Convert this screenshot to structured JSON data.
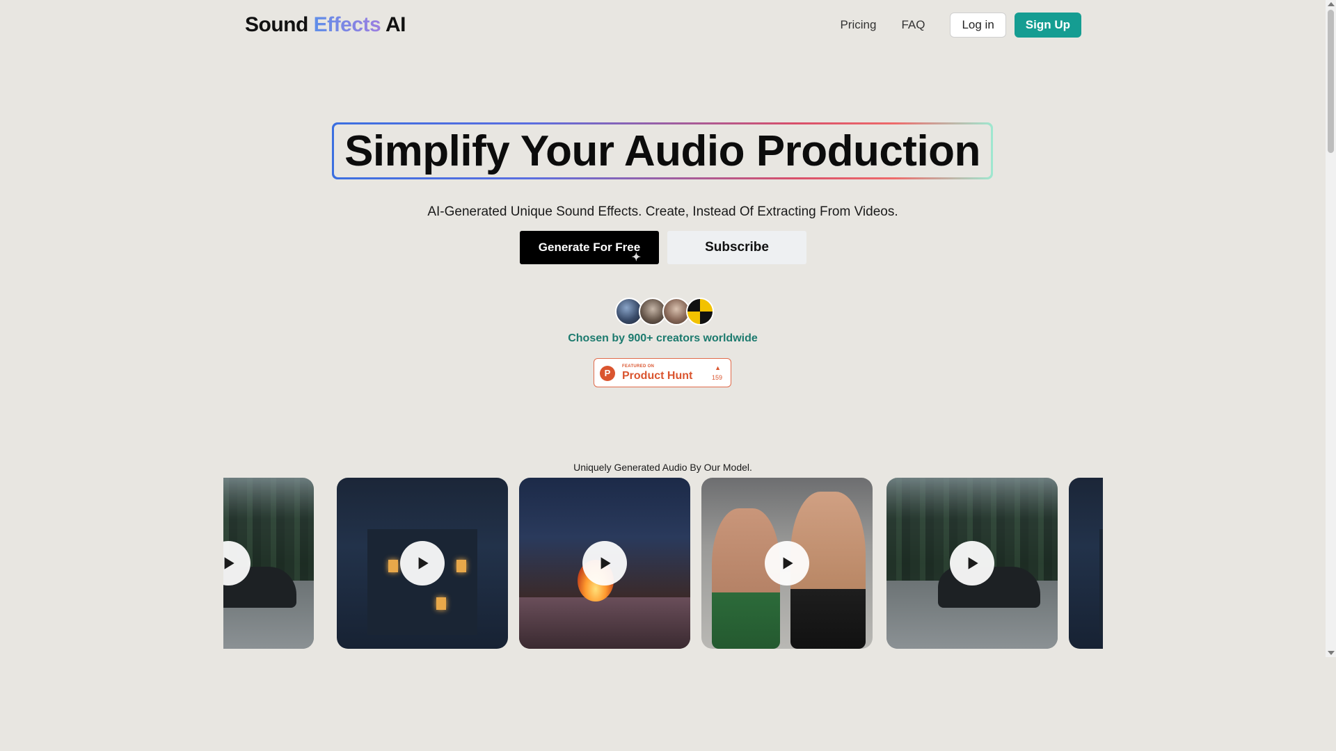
{
  "header": {
    "logo": {
      "part1": "Sound",
      "part2": "Effects",
      "part3": "AI"
    },
    "nav": {
      "pricing": "Pricing",
      "faq": "FAQ",
      "login": "Log in",
      "signup": "Sign Up"
    }
  },
  "hero": {
    "title": "Simplify Your Audio Production",
    "subtitle": "AI-Generated Unique Sound Effects. Create, Instead Of Extracting From Videos.",
    "cta_primary": "Generate For Free",
    "cta_secondary": "Subscribe"
  },
  "social_proof": {
    "chosen_text": "Chosen by 900+ creators worldwide",
    "product_hunt": {
      "featured": "FEATURED ON",
      "name": "Product Hunt",
      "count": "159"
    }
  },
  "gallery": {
    "label": "Uniquely Generated Audio By Our Model.",
    "cards": [
      {
        "scene": "car-on-road"
      },
      {
        "scene": "house-in-rain"
      },
      {
        "scene": "fireplace-cabin"
      },
      {
        "scene": "mma-fight"
      },
      {
        "scene": "car-on-road"
      },
      {
        "scene": "house-in-rain"
      }
    ]
  },
  "colors": {
    "background": "#e8e6e1",
    "accent_teal": "#159d92",
    "chosen_text": "#1c7a6e",
    "product_hunt": "#da552f"
  },
  "icons": {
    "play": "play-icon",
    "sparkle": "sparkle-icon",
    "product_hunt_logo": "product-hunt-icon",
    "upvote": "upvote-arrow-icon"
  }
}
